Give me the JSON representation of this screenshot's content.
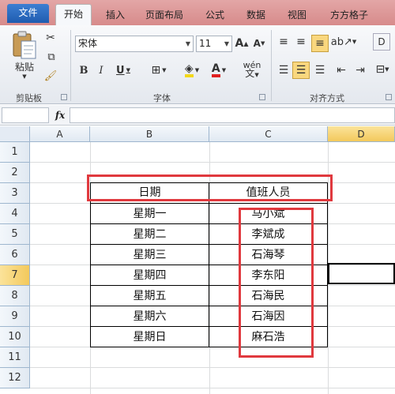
{
  "ribbon": {
    "tabs": [
      "文件",
      "开始",
      "插入",
      "页面布局",
      "公式",
      "数据",
      "视图",
      "方方格子"
    ],
    "active_tab": "开始",
    "groups": {
      "clipboard": {
        "paste_label": "粘贴",
        "group_label": "剪贴板"
      },
      "font": {
        "font_name": "宋体",
        "font_size": "11",
        "group_label": "字体"
      },
      "alignment": {
        "group_label": "对齐方式"
      }
    }
  },
  "formula_bar": {
    "fx_label": "fx",
    "value": ""
  },
  "columns": [
    "A",
    "B",
    "C",
    "D"
  ],
  "rows": [
    "1",
    "2",
    "3",
    "4",
    "5",
    "6",
    "7",
    "8",
    "9",
    "10",
    "11",
    "12"
  ],
  "table": {
    "headers": [
      "日期",
      "值班人员"
    ],
    "rows": [
      [
        "星期一",
        "马小斌"
      ],
      [
        "星期二",
        "李斌成"
      ],
      [
        "星期三",
        "石海琴"
      ],
      [
        "星期四",
        "李东阳"
      ],
      [
        "星期五",
        "石海民"
      ],
      [
        "星期六",
        "石海因"
      ],
      [
        "星期日",
        "麻石浩"
      ]
    ]
  },
  "selection": {
    "column": "D",
    "row": "7"
  },
  "accent_colors": {
    "highlight_box": "#e0393e",
    "ribbon_tab": "#d78b8b",
    "selected_header": "#f3c95c"
  }
}
